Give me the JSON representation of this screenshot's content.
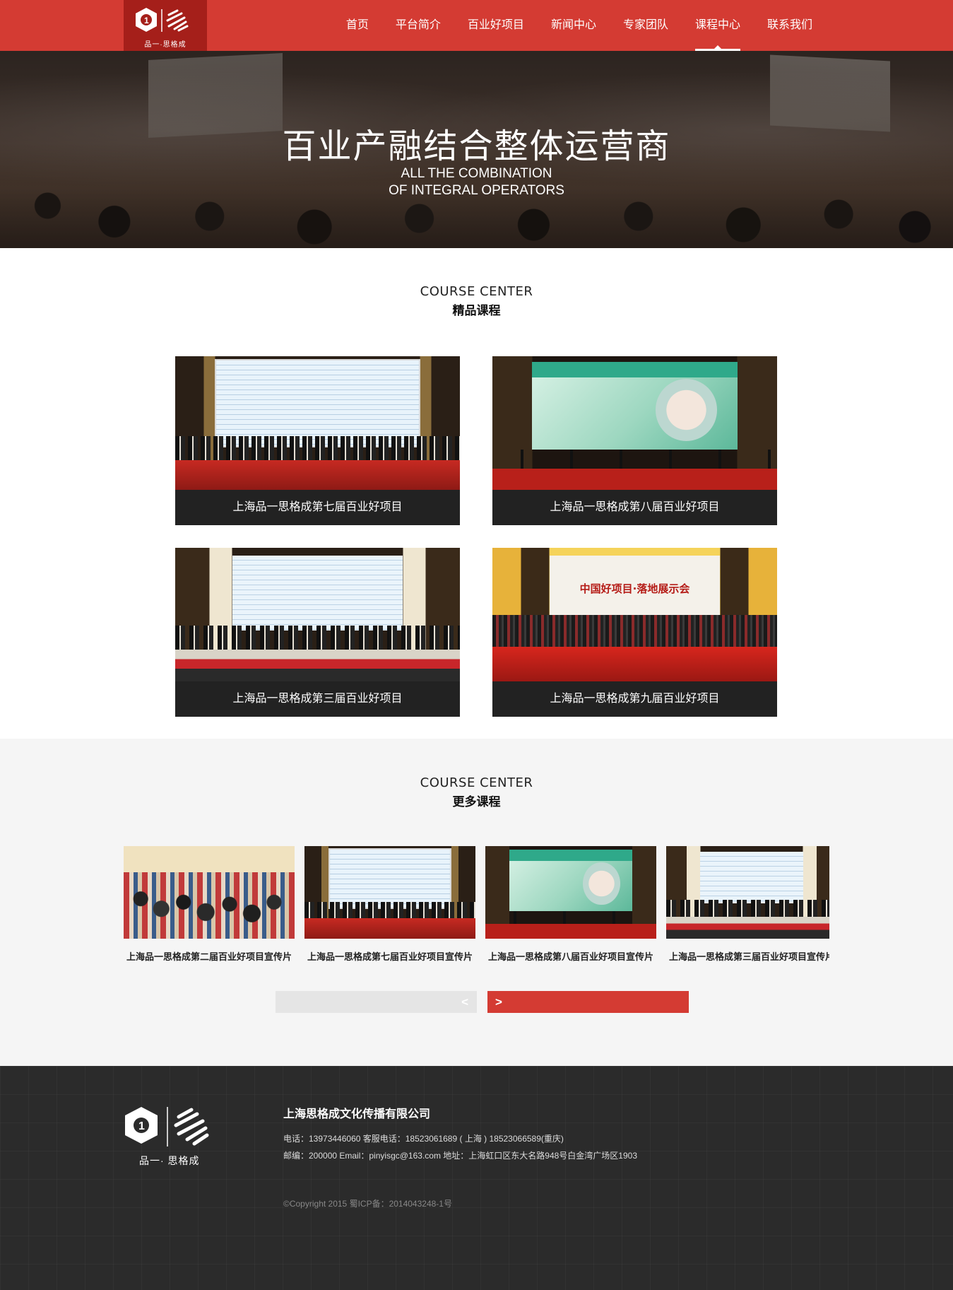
{
  "header": {
    "logo_caption": "品一·思格成",
    "nav": [
      {
        "label": "首页"
      },
      {
        "label": "平台简介"
      },
      {
        "label": "百业好项目"
      },
      {
        "label": "新闻中心"
      },
      {
        "label": "专家团队"
      },
      {
        "label": "课程中心",
        "active": true
      },
      {
        "label": "联系我们"
      }
    ],
    "colors": {
      "brand_red": "#d43b33",
      "logo_bg": "#a51f1a"
    }
  },
  "banner": {
    "title": "百业产融结合整体运营商",
    "subtitle_line1": "ALL THE COMBINATION",
    "subtitle_line2": "OF INTEGRAL OPERATORS"
  },
  "featured": {
    "heading_en": "COURSE CENTER",
    "heading_zh": "精品课程",
    "items": [
      {
        "label": "上海品一思格成第七届百业好项目"
      },
      {
        "label": "上海品一思格成第八届百业好项目"
      },
      {
        "label": "上海品一思格成第三届百业好项目"
      },
      {
        "label": "上海品一思格成第九届百业好项目"
      }
    ]
  },
  "more": {
    "heading_en": "COURSE CENTER",
    "heading_zh": "更多课程",
    "items": [
      {
        "title": "上海品一思格成第二届百业好项目宣传片"
      },
      {
        "title": "上海品一思格成第七届百业好项目宣传片"
      },
      {
        "title": "上海品一思格成第八届百业好项目宣传片"
      },
      {
        "title": "上海品一思格成第三届百业好项目宣传片"
      }
    ],
    "prev_label": "<",
    "next_label": ">"
  },
  "footer": {
    "logo_caption": "品一· 思格成",
    "company": "上海思格成文化传播有限公司",
    "line1": "电话：13973446060    客服电话：18523061689 ( 上海 )    18523066589(重庆)",
    "line2": "邮编：200000    Email：pinyisgc@163.com    地址：上海虹口区东大名路948号白金湾广场区1903",
    "copyright": "©Copyright 2015 蜀ICP备：2014043248-1号"
  }
}
